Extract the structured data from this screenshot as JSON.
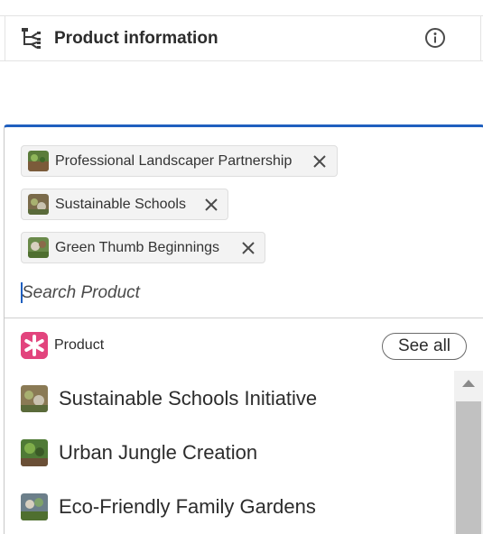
{
  "header": {
    "title": "Product information",
    "icon_left": "hierarchy-icon",
    "icon_right": "info-icon"
  },
  "selected_tags": [
    {
      "label": "Professional Landscaper Partnership",
      "thumb_color": "#5b7c3a"
    },
    {
      "label": "Sustainable Schools",
      "thumb_color": "#7a6a4a"
    },
    {
      "label": "Green Thumb Beginnings",
      "thumb_color": "#6a8a4a"
    }
  ],
  "search": {
    "placeholder": "Search Product",
    "value": ""
  },
  "section": {
    "label": "Product",
    "see_all_label": "See all",
    "badge_color": "#e2447d"
  },
  "results": [
    {
      "label": "Sustainable Schools Initiative",
      "thumb_color": "#8a7a55"
    },
    {
      "label": "Urban Jungle Creation",
      "thumb_color": "#4f7a36"
    },
    {
      "label": "Eco-Friendly Family Gardens",
      "thumb_color": "#6c7f8a"
    }
  ],
  "colors": {
    "accent": "#1f5fbf",
    "text": "#2c2c2c"
  }
}
